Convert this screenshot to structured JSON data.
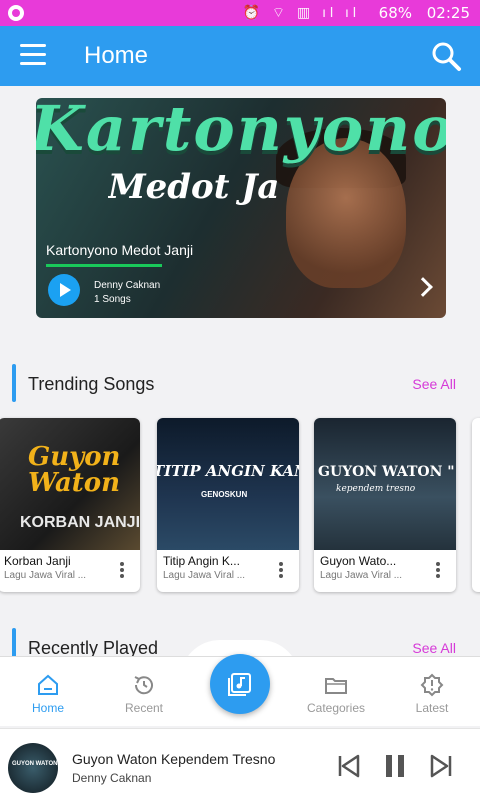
{
  "status_bar": {
    "battery": "68%",
    "time": "02:25"
  },
  "app_bar": {
    "title": "Home"
  },
  "banner": {
    "title": "Kartonyono Medot Janji",
    "artist": "Denny Caknan",
    "song_count": "1 Songs"
  },
  "trending": {
    "heading": "Trending Songs",
    "see_all": "See All",
    "cards": [
      {
        "title": "Korban Janji",
        "subtitle": "Lagu Jawa Viral ..."
      },
      {
        "title": "Titip Angin K...",
        "subtitle": "Lagu Jawa Viral ..."
      },
      {
        "title": "Guyon Wato...",
        "subtitle": "Lagu Jawa Viral ..."
      }
    ]
  },
  "recently_played": {
    "heading": "Recently Played",
    "see_all": "See All"
  },
  "bottom_nav": {
    "items": [
      {
        "label": "Home",
        "icon": "home-icon",
        "active": true
      },
      {
        "label": "Recent",
        "icon": "history-icon",
        "active": false
      },
      {
        "label": "Categories",
        "icon": "folder-icon",
        "active": false
      },
      {
        "label": "Latest",
        "icon": "alert-icon",
        "active": false
      }
    ]
  },
  "player": {
    "title": "Guyon Waton Kependem Tresno",
    "artist": "Denny Caknan"
  },
  "colors": {
    "status_bar": "#e83ad9",
    "app_bar": "#2d9cf0",
    "accent": "#d63ad8",
    "progress": "#19c95a"
  }
}
